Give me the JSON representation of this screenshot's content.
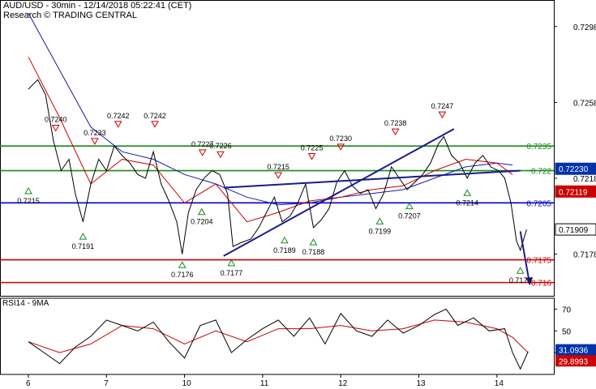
{
  "header": {
    "title": "AUD/USD - 30min - 12/14/2018 05:22:41 (CET)",
    "source": "Research © TRADING CENTRAL"
  },
  "colors": {
    "price": "#000000",
    "ma_fast": "#cc0000",
    "ma_slow": "#1a1aa6",
    "resistance": "#1a8a1a",
    "pivot": "#0000cc",
    "support": "#cc0000",
    "channel": "#1a1a8c",
    "arrow": "#1a1a8c",
    "badge_blue": "#0033aa",
    "badge_red": "#cc0000"
  },
  "chart_data": [
    {
      "type": "line",
      "name": "price",
      "y_axis": {
        "range": [
          0.7156,
          0.7312
        ],
        "ticks": [
          0.7298,
          0.7258,
          0.7218,
          0.7178
        ]
      },
      "x_axis": {
        "tick_labels": [
          "6",
          "7",
          "10",
          "11",
          "12",
          "13",
          "14"
        ]
      },
      "grid": false,
      "levels": [
        {
          "value": 0.7235,
          "label": "0.7235",
          "kind": "resistance"
        },
        {
          "value": 0.7222,
          "label": "0.722",
          "kind": "resistance"
        },
        {
          "value": 0.7205,
          "label": "0.7205",
          "kind": "pivot"
        },
        {
          "value": 0.7175,
          "label": "0.7175",
          "kind": "support"
        },
        {
          "value": 0.7163,
          "label": "0.716",
          "kind": "support"
        }
      ],
      "badges": [
        {
          "value": 0.7223,
          "label": "0.72230",
          "color": "#0033aa"
        },
        {
          "value": 0.7211,
          "label": "0.72119",
          "color": "#cc0000"
        },
        {
          "value": 0.7191,
          "label": "0.71909",
          "color": "#ffffff"
        }
      ],
      "pivots": [
        {
          "t": 0.0,
          "v": 0.7215,
          "label": "0.7215",
          "dir": "low"
        },
        {
          "t": 0.35,
          "v": 0.724,
          "label": "0.7240",
          "dir": "high"
        },
        {
          "t": 0.7,
          "v": 0.7191,
          "label": "0.7191",
          "dir": "low"
        },
        {
          "t": 0.85,
          "v": 0.7233,
          "label": "0.7233",
          "dir": "high"
        },
        {
          "t": 1.15,
          "v": 0.7242,
          "label": "0.7242",
          "dir": "high"
        },
        {
          "t": 1.62,
          "v": 0.7242,
          "label": "0.7242",
          "dir": "high"
        },
        {
          "t": 1.97,
          "v": 0.7176,
          "label": "0.7176",
          "dir": "low"
        },
        {
          "t": 2.22,
          "v": 0.7204,
          "label": "0.7204",
          "dir": "low"
        },
        {
          "t": 2.23,
          "v": 0.7227,
          "label": "0.7227",
          "dir": "high"
        },
        {
          "t": 2.46,
          "v": 0.7226,
          "label": "0.7226",
          "dir": "high"
        },
        {
          "t": 2.6,
          "v": 0.7177,
          "label": "0.7177",
          "dir": "low"
        },
        {
          "t": 3.2,
          "v": 0.7215,
          "label": "0.7215",
          "dir": "high"
        },
        {
          "t": 3.28,
          "v": 0.7189,
          "label": "0.7189",
          "dir": "low"
        },
        {
          "t": 3.63,
          "v": 0.7225,
          "label": "0.7225",
          "dir": "high"
        },
        {
          "t": 3.65,
          "v": 0.7188,
          "label": "0.7188",
          "dir": "low"
        },
        {
          "t": 4.0,
          "v": 0.723,
          "label": "0.7230",
          "dir": "high"
        },
        {
          "t": 4.5,
          "v": 0.7199,
          "label": "0.7199",
          "dir": "low"
        },
        {
          "t": 4.7,
          "v": 0.7238,
          "label": "0.7238",
          "dir": "high"
        },
        {
          "t": 4.88,
          "v": 0.7207,
          "label": "0.7207",
          "dir": "low"
        },
        {
          "t": 5.3,
          "v": 0.7247,
          "label": "0.7247",
          "dir": "high"
        },
        {
          "t": 5.62,
          "v": 0.7214,
          "label": "0.7214",
          "dir": "low"
        },
        {
          "t": 6.3,
          "v": 0.7173,
          "label": "0.7173",
          "dir": "low"
        }
      ],
      "close": [
        {
          "t": 0.0,
          "v": 0.7265
        },
        {
          "t": 0.12,
          "v": 0.727
        },
        {
          "t": 0.22,
          "v": 0.7262
        },
        {
          "t": 0.32,
          "v": 0.7238
        },
        {
          "t": 0.42,
          "v": 0.7222
        },
        {
          "t": 0.52,
          "v": 0.7228
        },
        {
          "t": 0.6,
          "v": 0.721
        },
        {
          "t": 0.7,
          "v": 0.7195
        },
        {
          "t": 0.8,
          "v": 0.7215
        },
        {
          "t": 0.9,
          "v": 0.7228
        },
        {
          "t": 1.0,
          "v": 0.7222
        },
        {
          "t": 1.1,
          "v": 0.7235
        },
        {
          "t": 1.2,
          "v": 0.723
        },
        {
          "t": 1.3,
          "v": 0.7226
        },
        {
          "t": 1.4,
          "v": 0.722
        },
        {
          "t": 1.5,
          "v": 0.7218
        },
        {
          "t": 1.6,
          "v": 0.7232
        },
        {
          "t": 1.7,
          "v": 0.7215
        },
        {
          "t": 1.8,
          "v": 0.7206
        },
        {
          "t": 1.9,
          "v": 0.7195
        },
        {
          "t": 1.97,
          "v": 0.7178
        },
        {
          "t": 2.05,
          "v": 0.72
        },
        {
          "t": 2.15,
          "v": 0.7212
        },
        {
          "t": 2.25,
          "v": 0.7218
        },
        {
          "t": 2.35,
          "v": 0.7222
        },
        {
          "t": 2.45,
          "v": 0.722
        },
        {
          "t": 2.55,
          "v": 0.721
        },
        {
          "t": 2.62,
          "v": 0.7182
        },
        {
          "t": 2.72,
          "v": 0.7184
        },
        {
          "t": 2.85,
          "v": 0.7186
        },
        {
          "t": 2.95,
          "v": 0.7192
        },
        {
          "t": 3.05,
          "v": 0.72
        },
        {
          "t": 3.15,
          "v": 0.7208
        },
        {
          "t": 3.25,
          "v": 0.7195
        },
        {
          "t": 3.35,
          "v": 0.7198
        },
        {
          "t": 3.45,
          "v": 0.7205
        },
        {
          "t": 3.55,
          "v": 0.7215
        },
        {
          "t": 3.65,
          "v": 0.7192
        },
        {
          "t": 3.75,
          "v": 0.7196
        },
        {
          "t": 3.85,
          "v": 0.7202
        },
        {
          "t": 3.95,
          "v": 0.7216
        },
        {
          "t": 4.05,
          "v": 0.7222
        },
        {
          "t": 4.15,
          "v": 0.7214
        },
        {
          "t": 4.25,
          "v": 0.721
        },
        {
          "t": 4.35,
          "v": 0.7212
        },
        {
          "t": 4.45,
          "v": 0.7202
        },
        {
          "t": 4.55,
          "v": 0.721
        },
        {
          "t": 4.65,
          "v": 0.7224
        },
        {
          "t": 4.75,
          "v": 0.7218
        },
        {
          "t": 4.85,
          "v": 0.7212
        },
        {
          "t": 4.95,
          "v": 0.7216
        },
        {
          "t": 5.05,
          "v": 0.722
        },
        {
          "t": 5.15,
          "v": 0.7226
        },
        {
          "t": 5.25,
          "v": 0.7236
        },
        {
          "t": 5.32,
          "v": 0.724
        },
        {
          "t": 5.42,
          "v": 0.723
        },
        {
          "t": 5.52,
          "v": 0.7226
        },
        {
          "t": 5.62,
          "v": 0.7218
        },
        {
          "t": 5.72,
          "v": 0.7226
        },
        {
          "t": 5.82,
          "v": 0.723
        },
        {
          "t": 5.92,
          "v": 0.7224
        },
        {
          "t": 6.02,
          "v": 0.7222
        },
        {
          "t": 6.1,
          "v": 0.7218
        },
        {
          "t": 6.18,
          "v": 0.7205
        },
        {
          "t": 6.25,
          "v": 0.7185
        },
        {
          "t": 6.3,
          "v": 0.718
        },
        {
          "t": 6.38,
          "v": 0.7191
        }
      ],
      "ma_fast": [
        {
          "t": 0.0,
          "v": 0.7282
        },
        {
          "t": 0.4,
          "v": 0.725
        },
        {
          "t": 0.8,
          "v": 0.7215
        },
        {
          "t": 1.2,
          "v": 0.7228
        },
        {
          "t": 1.6,
          "v": 0.7225
        },
        {
          "t": 2.0,
          "v": 0.7205
        },
        {
          "t": 2.4,
          "v": 0.7215
        },
        {
          "t": 2.8,
          "v": 0.7195
        },
        {
          "t": 3.2,
          "v": 0.72
        },
        {
          "t": 3.6,
          "v": 0.7206
        },
        {
          "t": 4.0,
          "v": 0.7208
        },
        {
          "t": 4.4,
          "v": 0.7212
        },
        {
          "t": 4.8,
          "v": 0.7214
        },
        {
          "t": 5.2,
          "v": 0.7222
        },
        {
          "t": 5.6,
          "v": 0.7228
        },
        {
          "t": 6.0,
          "v": 0.7226
        },
        {
          "t": 6.2,
          "v": 0.722
        }
      ],
      "ma_slow": [
        {
          "t": 0.0,
          "v": 0.7305
        },
        {
          "t": 0.4,
          "v": 0.7275
        },
        {
          "t": 0.8,
          "v": 0.7245
        },
        {
          "t": 1.2,
          "v": 0.7232
        },
        {
          "t": 1.6,
          "v": 0.7228
        },
        {
          "t": 2.0,
          "v": 0.722
        },
        {
          "t": 2.4,
          "v": 0.7215
        },
        {
          "t": 2.8,
          "v": 0.7208
        },
        {
          "t": 3.2,
          "v": 0.7204
        },
        {
          "t": 3.6,
          "v": 0.7205
        },
        {
          "t": 4.0,
          "v": 0.7208
        },
        {
          "t": 4.4,
          "v": 0.721
        },
        {
          "t": 4.8,
          "v": 0.7212
        },
        {
          "t": 5.2,
          "v": 0.7218
        },
        {
          "t": 5.6,
          "v": 0.7224
        },
        {
          "t": 6.0,
          "v": 0.7226
        },
        {
          "t": 6.2,
          "v": 0.7225
        }
      ],
      "channel": [
        {
          "t0": 2.5,
          "v0": 0.7177,
          "t1": 5.45,
          "v1": 0.7244
        },
        {
          "t0": 2.5,
          "v0": 0.7213,
          "t1": 6.3,
          "v1": 0.7222
        }
      ],
      "arrow": {
        "t0": 6.3,
        "v0": 0.719,
        "t1": 6.42,
        "v1": 0.7162
      }
    },
    {
      "type": "line",
      "name": "RSI14 - 9MA",
      "y_axis": {
        "range": [
          10,
          80
        ],
        "ticks": [
          70,
          50,
          30
        ]
      },
      "badges": [
        {
          "value": 31.0936,
          "label": "31.0936",
          "color": "#0033aa"
        },
        {
          "value": 29.8993,
          "label": "29.8993",
          "color": "#cc0000"
        }
      ],
      "rsi": [
        {
          "t": 0.0,
          "v": 40
        },
        {
          "t": 0.2,
          "v": 30
        },
        {
          "t": 0.4,
          "v": 20
        },
        {
          "t": 0.6,
          "v": 35
        },
        {
          "t": 0.8,
          "v": 45
        },
        {
          "t": 1.0,
          "v": 60
        },
        {
          "t": 1.2,
          "v": 55
        },
        {
          "t": 1.4,
          "v": 50
        },
        {
          "t": 1.6,
          "v": 58
        },
        {
          "t": 1.8,
          "v": 40
        },
        {
          "t": 2.0,
          "v": 25
        },
        {
          "t": 2.2,
          "v": 55
        },
        {
          "t": 2.4,
          "v": 60
        },
        {
          "t": 2.6,
          "v": 30
        },
        {
          "t": 2.8,
          "v": 42
        },
        {
          "t": 3.0,
          "v": 52
        },
        {
          "t": 3.2,
          "v": 60
        },
        {
          "t": 3.4,
          "v": 45
        },
        {
          "t": 3.6,
          "v": 62
        },
        {
          "t": 3.8,
          "v": 38
        },
        {
          "t": 4.0,
          "v": 66
        },
        {
          "t": 4.2,
          "v": 50
        },
        {
          "t": 4.4,
          "v": 45
        },
        {
          "t": 4.6,
          "v": 60
        },
        {
          "t": 4.8,
          "v": 48
        },
        {
          "t": 5.0,
          "v": 55
        },
        {
          "t": 5.2,
          "v": 65
        },
        {
          "t": 5.35,
          "v": 70
        },
        {
          "t": 5.5,
          "v": 55
        },
        {
          "t": 5.7,
          "v": 62
        },
        {
          "t": 5.9,
          "v": 50
        },
        {
          "t": 6.1,
          "v": 52
        },
        {
          "t": 6.2,
          "v": 30
        },
        {
          "t": 6.3,
          "v": 15
        },
        {
          "t": 6.4,
          "v": 31
        }
      ],
      "ma": [
        {
          "t": 0.0,
          "v": 40
        },
        {
          "t": 0.4,
          "v": 30
        },
        {
          "t": 0.8,
          "v": 38
        },
        {
          "t": 1.2,
          "v": 55
        },
        {
          "t": 1.6,
          "v": 52
        },
        {
          "t": 2.0,
          "v": 38
        },
        {
          "t": 2.4,
          "v": 50
        },
        {
          "t": 2.8,
          "v": 40
        },
        {
          "t": 3.2,
          "v": 52
        },
        {
          "t": 3.6,
          "v": 52
        },
        {
          "t": 4.0,
          "v": 55
        },
        {
          "t": 4.4,
          "v": 50
        },
        {
          "t": 4.8,
          "v": 52
        },
        {
          "t": 5.2,
          "v": 60
        },
        {
          "t": 5.6,
          "v": 58
        },
        {
          "t": 6.0,
          "v": 52
        },
        {
          "t": 6.2,
          "v": 44
        },
        {
          "t": 6.4,
          "v": 30
        }
      ]
    }
  ]
}
